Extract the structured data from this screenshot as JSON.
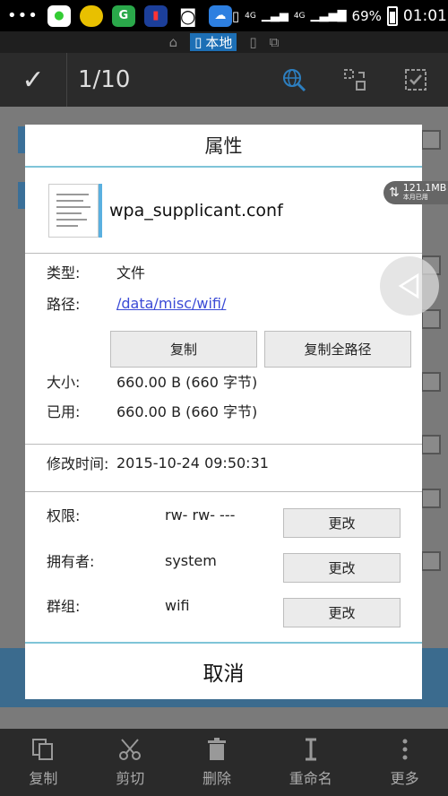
{
  "status_bar": {
    "dots": "•••",
    "network_top": "4G",
    "network_main": "4G",
    "battery": "69%",
    "time": "01:01"
  },
  "tabstrip": {
    "local_label": "本地"
  },
  "action_bar": {
    "selection_count": "1/10"
  },
  "dialog": {
    "title": "属性",
    "file_name": "wpa_supplicant.conf",
    "type_label": "类型:",
    "type_value": "文件",
    "path_label": "路径:",
    "path_value": "/data/misc/wifi/",
    "copy_button": "复制",
    "copy_full_path_button": "复制全路径",
    "size_label": "大小:",
    "size_value": "660.00 B (660 字节)",
    "used_label": "已用:",
    "used_value": "660.00 B (660 字节)",
    "modified_label": "修改时间:",
    "modified_value": "2015-10-24 09:50:31",
    "permissions_label": "权限:",
    "permissions_value": "rw- rw- ---",
    "owner_label": "拥有者:",
    "owner_value": "system",
    "group_label": "群组:",
    "group_value": "wifi",
    "change_button": "更改",
    "cancel_button": "取消"
  },
  "net_badge": {
    "amount": "121.1MB",
    "caption": "本月已用"
  },
  "bottom_bar": {
    "items": [
      {
        "label": "复制",
        "icon": "copy-icon"
      },
      {
        "label": "剪切",
        "icon": "scissors-icon"
      },
      {
        "label": "删除",
        "icon": "trash-icon"
      },
      {
        "label": "重命名",
        "icon": "rename-icon"
      },
      {
        "label": "更多",
        "icon": "more-icon"
      }
    ]
  },
  "colors": {
    "accent": "#7fc4d8",
    "link": "#3b4bd6",
    "tab_active": "#1d6fb5"
  }
}
